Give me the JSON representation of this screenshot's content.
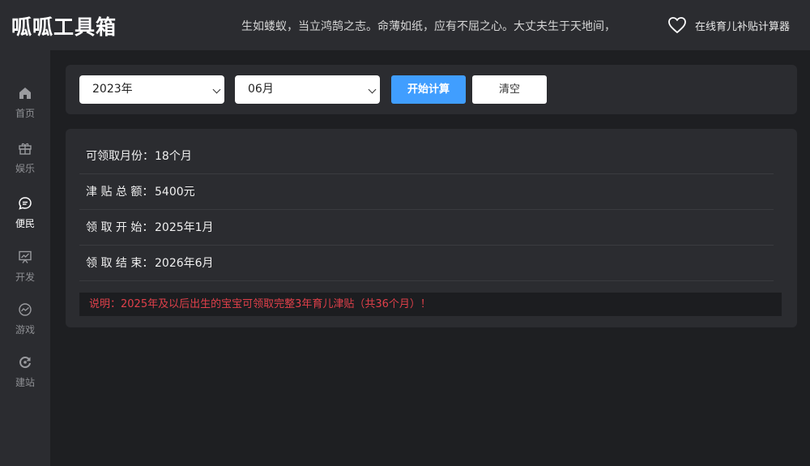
{
  "header": {
    "logo": "呱呱工具箱",
    "slogan": "生如蝼蚁，当立鸿鹄之志。命薄如纸，应有不屈之心。大丈夫生于天地间，",
    "favorite_label": "在线育儿补贴计算器",
    "favorite_icon": "heart-icon"
  },
  "sidebar": {
    "items": [
      {
        "label": "首页",
        "icon": "home-icon",
        "active": false
      },
      {
        "label": "娱乐",
        "icon": "gift-icon",
        "active": false
      },
      {
        "label": "便民",
        "icon": "chat-icon",
        "active": true
      },
      {
        "label": "开发",
        "icon": "chart-board-icon",
        "active": false
      },
      {
        "label": "游戏",
        "icon": "trend-circle-icon",
        "active": false
      },
      {
        "label": "建站",
        "icon": "refresh-icon",
        "active": false
      }
    ]
  },
  "form": {
    "year_value": "2023年",
    "month_value": "06月",
    "calculate_label": "开始计算",
    "clear_label": "清空"
  },
  "result": {
    "rows": [
      {
        "label": "可领取月份：",
        "value": "18个月"
      },
      {
        "label": "津 贴 总 额：",
        "value": "5400元"
      },
      {
        "label": "领 取 开 始：",
        "value": "2025年1月"
      },
      {
        "label": "领 取 结 束：",
        "value": "2026年6月"
      }
    ],
    "note": "说明：2025年及以后出生的宝宝可领取完整3年育儿津贴（共36个月）！"
  },
  "colors": {
    "accent": "#409eff",
    "note_text": "#e0404a",
    "background": "#1e1f22",
    "panel": "#2b2c30"
  }
}
